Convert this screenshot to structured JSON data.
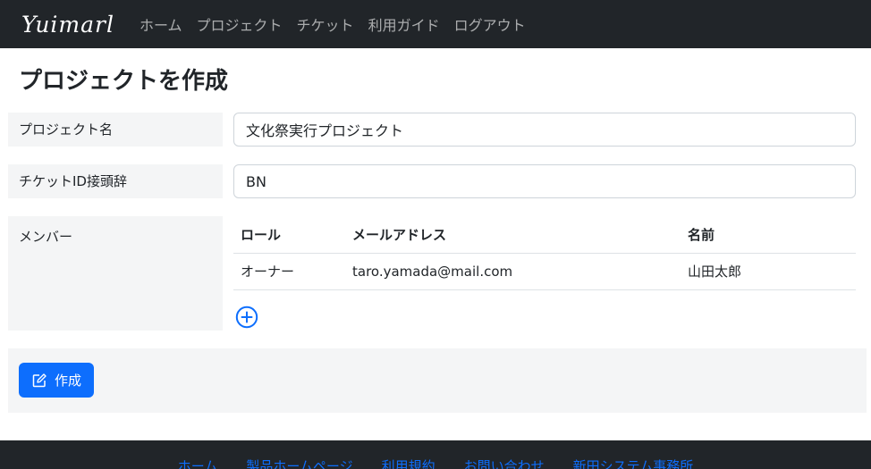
{
  "nav": {
    "brand": "Yuimarl",
    "links": [
      "ホーム",
      "プロジェクト",
      "チケット",
      "利用ガイド",
      "ログアウト"
    ]
  },
  "page": {
    "title": "プロジェクトを作成"
  },
  "form": {
    "name_label": "プロジェクト名",
    "name_value": "文化祭実行プロジェクト",
    "prefix_label": "チケットID接頭辞",
    "prefix_value": "BN",
    "members_label": "メンバー",
    "members_table": {
      "headers": [
        "ロール",
        "メールアドレス",
        "名前"
      ],
      "rows": [
        [
          "オーナー",
          "taro.yamada@mail.com",
          "山田太郎"
        ]
      ]
    },
    "add_member_icon": "plus-circle-icon",
    "create_label": "作成",
    "create_icon": "edit-icon"
  },
  "footer": {
    "links": [
      "ホーム",
      "製品ホームページ",
      "利用規約",
      "お問い合わせ",
      "新田システム事務所"
    ]
  },
  "colors": {
    "navbar": "#212529",
    "primary": "#0d6efd",
    "label_bg": "#f4f5f6"
  }
}
